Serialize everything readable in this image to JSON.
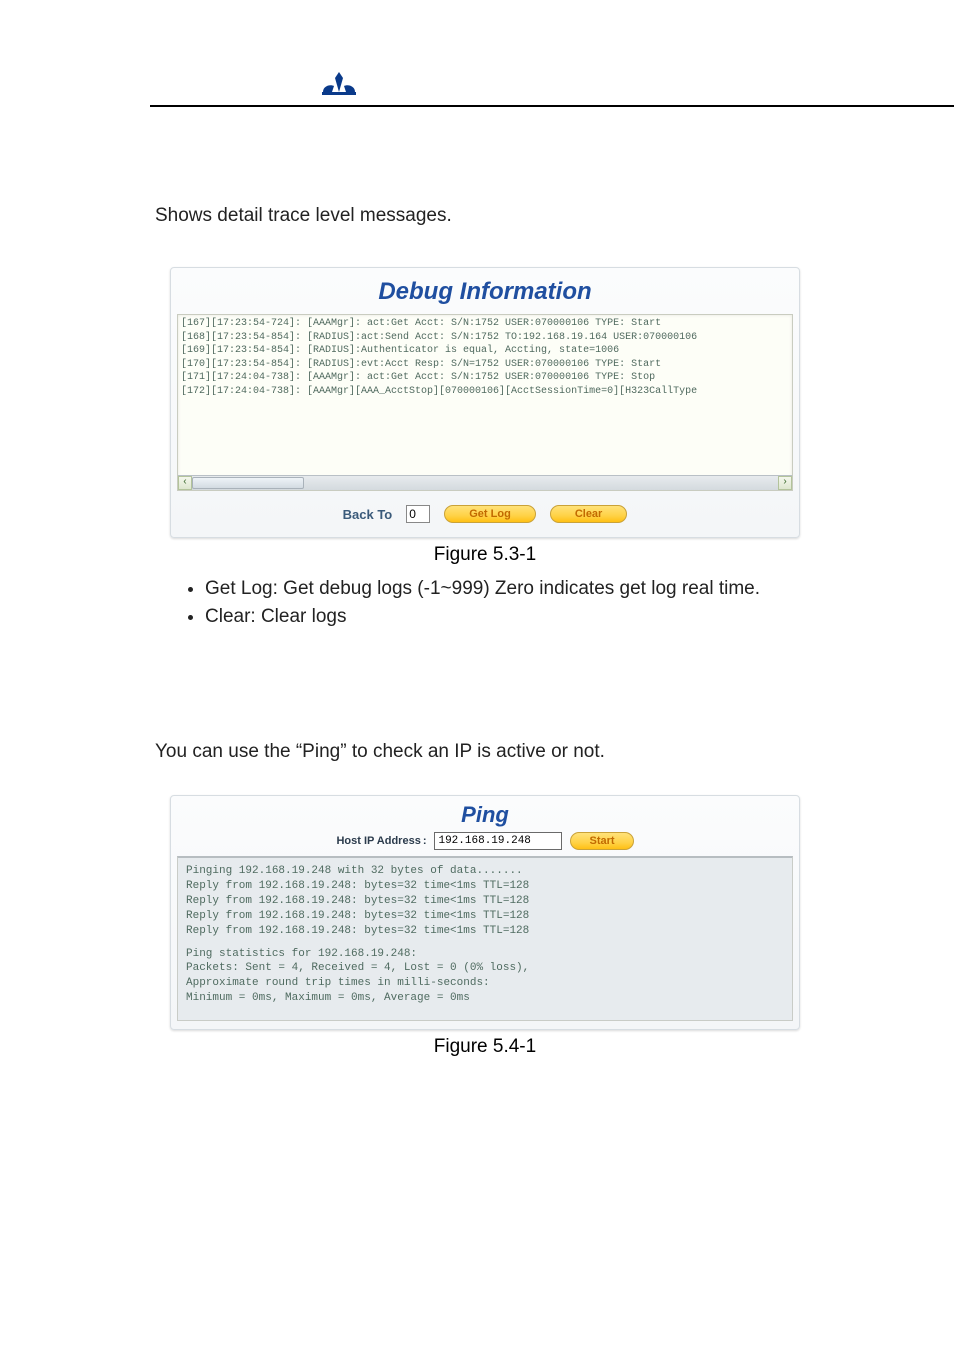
{
  "intro1": "Shows detail trace level messages.",
  "debug": {
    "title": "Debug Information",
    "log_lines": [
      "[167][17:23:54-724]: [AAAMgr]: act:Get Acct: S/N:1752 USER:070000106 TYPE: Start",
      "[168][17:23:54-854]: [RADIUS]:act:Send Acct: S/N:1752 TO:192.168.19.164 USER:070000106",
      "[169][17:23:54-854]: [RADIUS]:Authenticator is equal, Accting, state=1006",
      "[170][17:23:54-854]: [RADIUS]:evt:Acct Resp: S/N=1752 USER:070000106 TYPE: Start",
      "[171][17:24:04-738]: [AAAMgr]: act:Get Acct: S/N:1752 USER:070000106 TYPE: Stop",
      "[172][17:24:04-738]: [AAAMgr][AAA_AcctStop][070000106][AcctSessionTime=0][H323CallType"
    ],
    "backto_label": "Back To",
    "backto_value": "0",
    "getlog_label": "Get Log",
    "clear_label": "Clear"
  },
  "figcaption1": "Figure 5.3-1",
  "bullets": {
    "items": [
      "Get Log: Get debug logs (-1~999)  Zero indicates get log real time.",
      "Clear: Clear logs"
    ]
  },
  "intro2": "You can use the “Ping” to check an IP is active or not.",
  "ping": {
    "title": "Ping",
    "host_label": "Host IP Address",
    "host_value": "192.168.19.248",
    "start_label": "Start",
    "output_lines_1": [
      "Pinging 192.168.19.248 with 32 bytes of data.......",
      "Reply from 192.168.19.248: bytes=32 time<1ms TTL=128",
      "Reply from 192.168.19.248: bytes=32 time<1ms TTL=128",
      "Reply from 192.168.19.248: bytes=32 time<1ms TTL=128",
      "Reply from 192.168.19.248: bytes=32 time<1ms TTL=128"
    ],
    "output_lines_2": [
      "Ping statistics for 192.168.19.248:",
      "Packets: Sent = 4, Received = 4, Lost = 0 (0% loss),",
      "Approximate round trip times in milli-seconds:",
      "Minimum = 0ms, Maximum = 0ms, Average = 0ms"
    ]
  },
  "figcaption2": "Figure 5.4-1"
}
